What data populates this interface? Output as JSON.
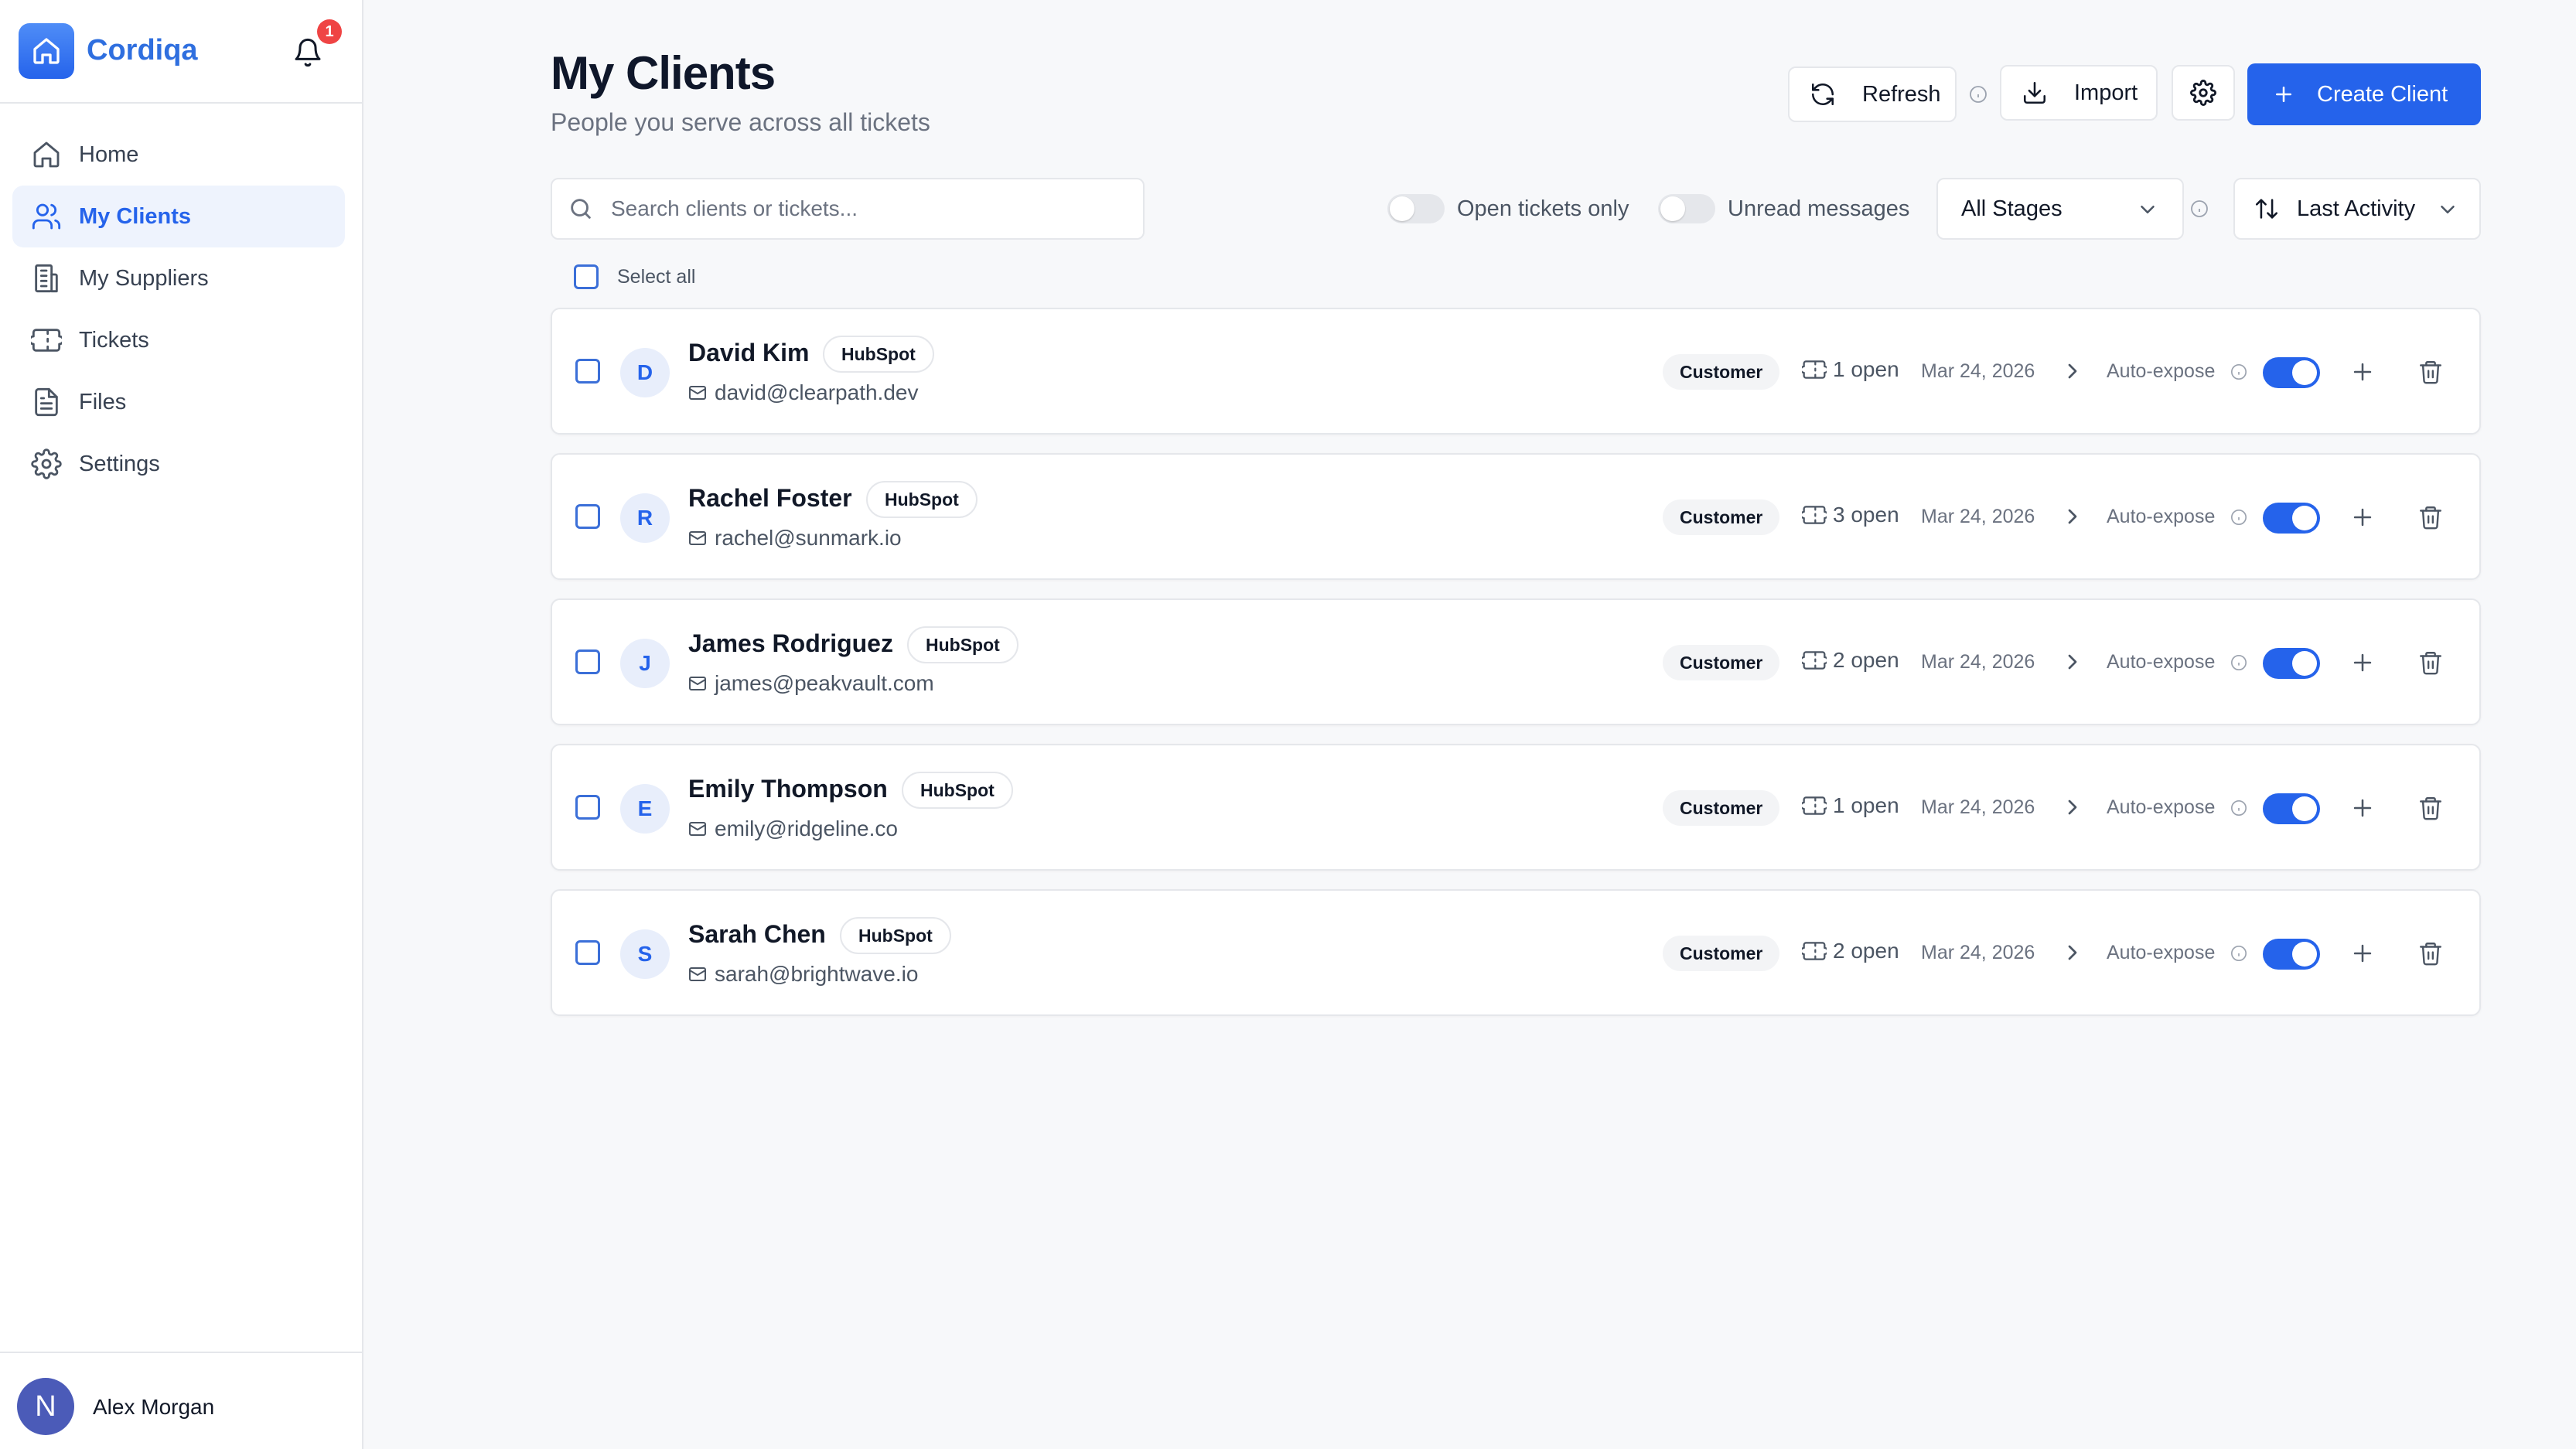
{
  "brand": {
    "name": "Cordiqa",
    "notifications": "1"
  },
  "nav": [
    {
      "label": "Home",
      "icon": "home-icon",
      "active": false
    },
    {
      "label": "My Clients",
      "icon": "users-icon",
      "active": true
    },
    {
      "label": "My Suppliers",
      "icon": "building-icon",
      "active": false
    },
    {
      "label": "Tickets",
      "icon": "ticket-icon",
      "active": false
    },
    {
      "label": "Files",
      "icon": "file-icon",
      "active": false
    },
    {
      "label": "Settings",
      "icon": "gear-icon",
      "active": false
    }
  ],
  "user": {
    "initial": "N",
    "name": "Alex Morgan"
  },
  "header": {
    "title": "My Clients",
    "subtitle": "People you serve across all tickets",
    "refresh_label": "Refresh",
    "import_label": "Import",
    "create_label": "Create Client"
  },
  "filters": {
    "search_placeholder": "Search clients or tickets...",
    "open_tickets_label": "Open tickets only",
    "unread_label": "Unread messages",
    "stage_value": "All Stages",
    "sort_value": "Last Activity",
    "select_all_label": "Select all"
  },
  "colors": {
    "accent": "#2563eb",
    "brand": "#2f6fdf",
    "badge": "#ef4444"
  },
  "clients": [
    {
      "initial": "D",
      "name": "David Kim",
      "source": "HubSpot",
      "email": "david@clearpath.dev",
      "stage": "Customer",
      "open": "1 open",
      "date": "Mar 24, 2026",
      "auto_expose": "Auto-expose"
    },
    {
      "initial": "R",
      "name": "Rachel Foster",
      "source": "HubSpot",
      "email": "rachel@sunmark.io",
      "stage": "Customer",
      "open": "3 open",
      "date": "Mar 24, 2026",
      "auto_expose": "Auto-expose"
    },
    {
      "initial": "J",
      "name": "James Rodriguez",
      "source": "HubSpot",
      "email": "james@peakvault.com",
      "stage": "Customer",
      "open": "2 open",
      "date": "Mar 24, 2026",
      "auto_expose": "Auto-expose"
    },
    {
      "initial": "E",
      "name": "Emily Thompson",
      "source": "HubSpot",
      "email": "emily@ridgeline.co",
      "stage": "Customer",
      "open": "1 open",
      "date": "Mar 24, 2026",
      "auto_expose": "Auto-expose"
    },
    {
      "initial": "S",
      "name": "Sarah Chen",
      "source": "HubSpot",
      "email": "sarah@brightwave.io",
      "stage": "Customer",
      "open": "2 open",
      "date": "Mar 24, 2026",
      "auto_expose": "Auto-expose"
    }
  ]
}
